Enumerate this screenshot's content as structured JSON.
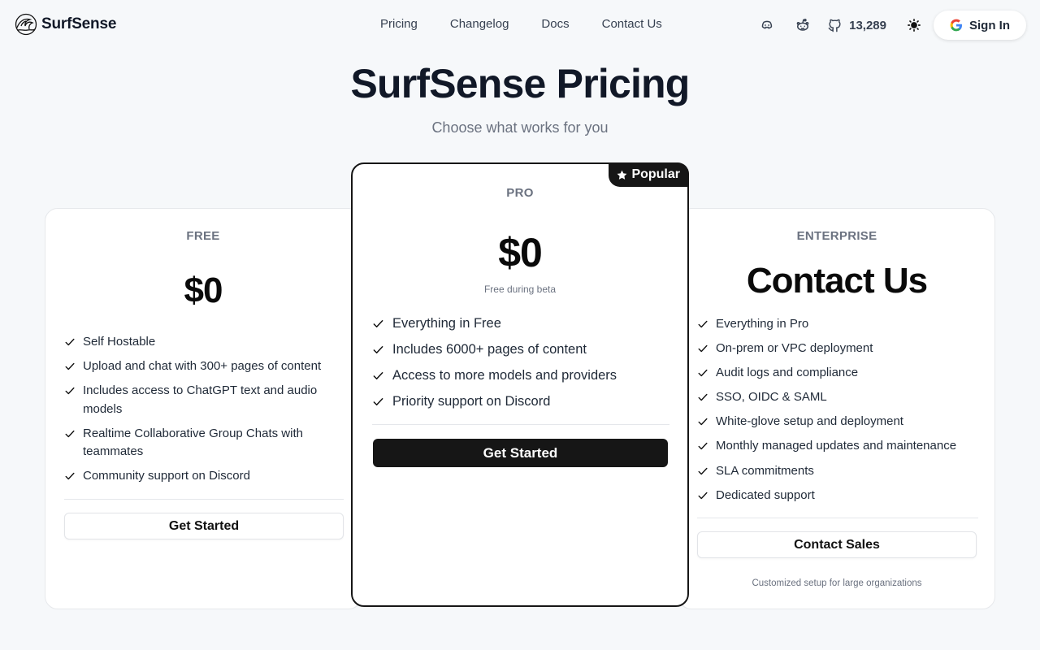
{
  "header": {
    "brand": "SurfSense",
    "nav": [
      {
        "label": "Pricing"
      },
      {
        "label": "Changelog"
      },
      {
        "label": "Docs"
      },
      {
        "label": "Contact Us"
      }
    ],
    "github_stars": "13,289",
    "sign_in": "Sign In",
    "icons": [
      "discord-icon",
      "reddit-icon",
      "github-icon",
      "sun-icon",
      "google-icon"
    ]
  },
  "hero": {
    "title": "SurfSense Pricing",
    "subtitle": "Choose what works for you"
  },
  "plans": {
    "free": {
      "tier": "FREE",
      "price": "$0",
      "features": [
        "Self Hostable",
        "Upload and chat with 300+ pages of content",
        "Includes access to ChatGPT text and audio models",
        "Realtime Collaborative Group Chats with teammates",
        "Community support on Discord"
      ],
      "cta": "Get Started"
    },
    "pro": {
      "badge": "Popular",
      "tier": "PRO",
      "price": "$0",
      "note": "Free during beta",
      "features": [
        "Everything in Free",
        "Includes 6000+ pages of content",
        "Access to more models and providers",
        "Priority support on Discord"
      ],
      "cta": "Get Started"
    },
    "enterprise": {
      "tier": "ENTERPRISE",
      "price": "Contact Us",
      "features": [
        "Everything in Pro",
        "On-prem or VPC deployment",
        "Audit logs and compliance",
        "SSO, OIDC & SAML",
        "White-glove setup and deployment",
        "Monthly managed updates and maintenance",
        "SLA commitments",
        "Dedicated support"
      ],
      "cta": "Contact Sales",
      "footnote": "Customized setup for large organizations"
    }
  },
  "colors": {
    "background": "#f6f8fa",
    "text": "#111827",
    "muted": "#6b7280",
    "dark_button": "#161616",
    "card": "#ffffff"
  }
}
